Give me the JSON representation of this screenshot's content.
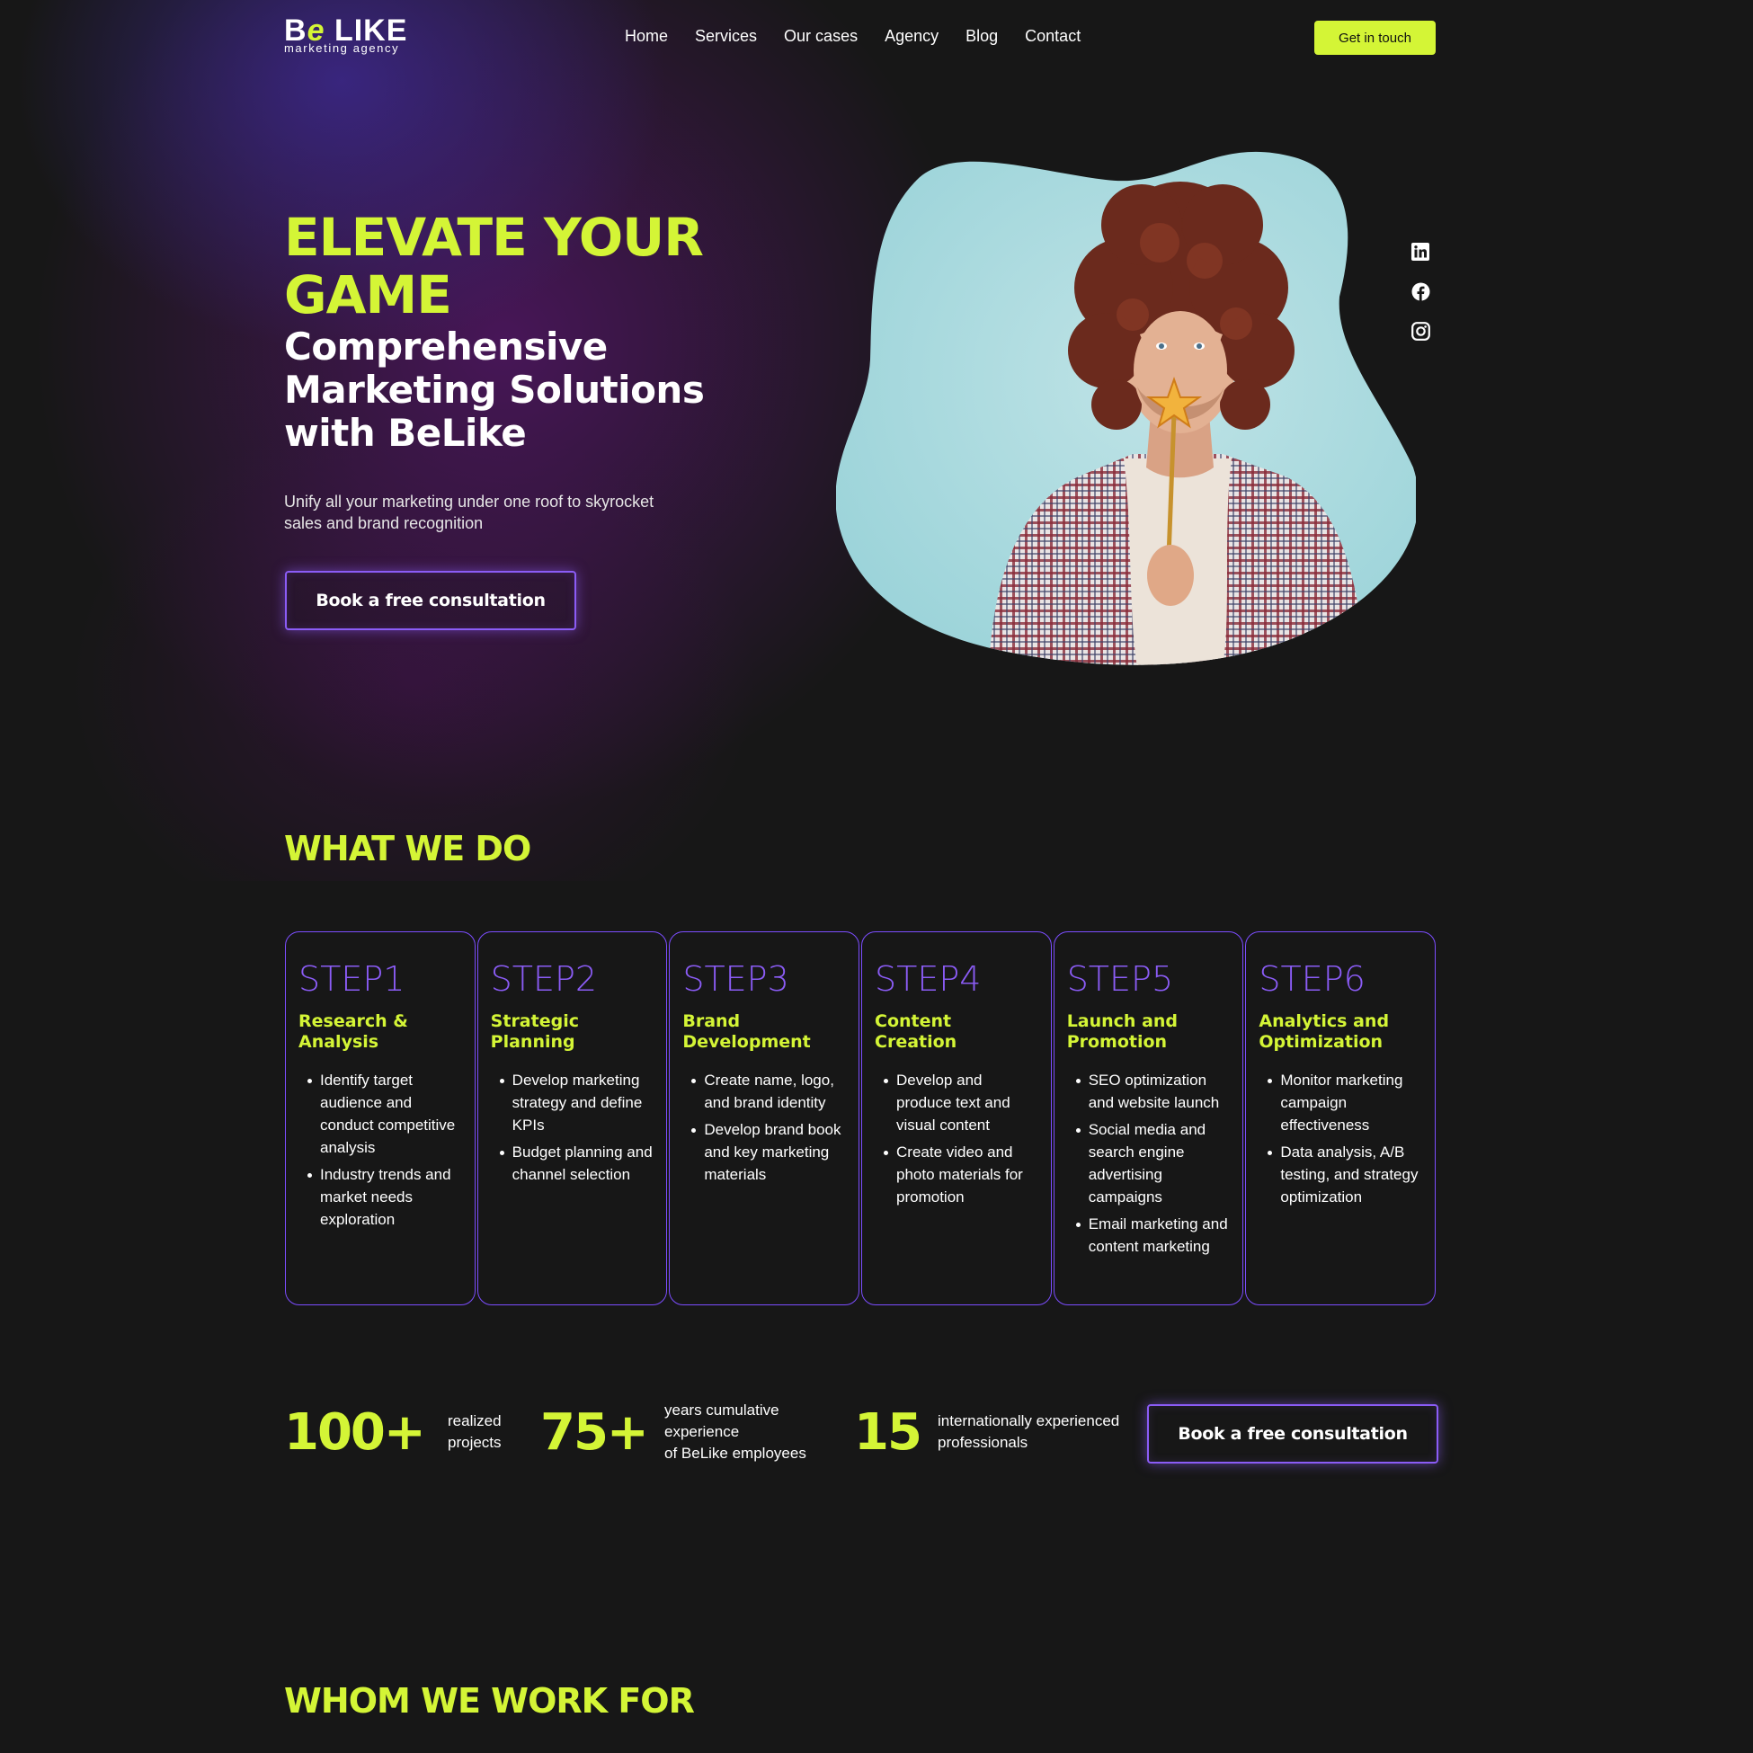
{
  "brand": {
    "logo_b": "B",
    "logo_e": "e",
    "logo_like": "LIKE",
    "tagline": "marketing agency",
    "accent": "#d4f536",
    "purple": "#8b5cf6"
  },
  "nav": {
    "items": [
      "Home",
      "Services",
      "Our cases",
      "Agency",
      "Blog",
      "Contact"
    ],
    "cta": "Get in touch"
  },
  "hero": {
    "title": "ELEVATE YOUR GAME",
    "subtitle": "Comprehensive Marketing Solutions with BeLike",
    "description": "Unify all your marketing under one roof to skyrocket sales and brand recognition",
    "cta": "Book a free consultation"
  },
  "social": [
    "linkedin-icon",
    "facebook-icon",
    "instagram-icon"
  ],
  "what_we_do": {
    "title": "WHAT WE DO",
    "steps": [
      {
        "label": "STEP1",
        "title": "Research & Analysis",
        "bullets": [
          "Identify target audience and conduct competitive analysis",
          "Industry trends and market needs exploration"
        ]
      },
      {
        "label": "STEP2",
        "title": "Strategic Planning",
        "bullets": [
          "Develop marketing strategy and define KPIs",
          "Budget planning and channel selection"
        ]
      },
      {
        "label": "STEP3",
        "title": "Brand Development",
        "bullets": [
          "Create name, logo, and brand identity",
          "Develop brand book and key marketing materials"
        ]
      },
      {
        "label": "STEP4",
        "title": "Content Creation",
        "bullets": [
          "Develop and produce text and visual content",
          "Create video and photo materials for promotion"
        ]
      },
      {
        "label": "STEP5",
        "title": "Launch and Promotion",
        "bullets": [
          "SEO optimization and website launch",
          "Social media and search engine advertising campaigns",
          "Email marketing and content marketing"
        ]
      },
      {
        "label": "STEP6",
        "title": "Analytics and Optimization",
        "bullets": [
          "Monitor marketing campaign effectiveness",
          "Data analysis, A/B testing, and strategy optimization"
        ]
      }
    ]
  },
  "stats": {
    "items": [
      {
        "value": "100+",
        "label_lines": [
          "realized",
          "projects"
        ]
      },
      {
        "value": "75+",
        "label_lines": [
          "years cumulative",
          "experience",
          "of BeLike employees"
        ]
      },
      {
        "value": "15",
        "label_lines": [
          "internationally experienced",
          "professionals"
        ]
      }
    ],
    "cta": "Book a free consultation"
  },
  "whom_we_work_for": {
    "title": "WHOM WE WORK FOR"
  }
}
